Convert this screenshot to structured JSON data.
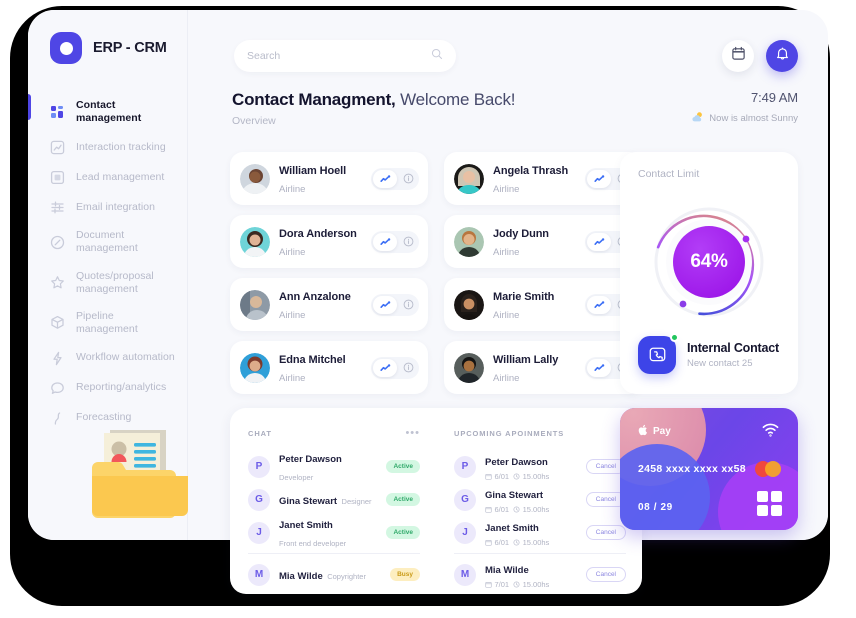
{
  "brand": {
    "name": "ERP - CRM",
    "logo_icon": "circle-logo-icon",
    "accent": "#4f46e5"
  },
  "sidebar": {
    "items": [
      {
        "label": "Contact management",
        "icon": "grid-icon",
        "active": true
      },
      {
        "label": "Interaction tracking",
        "icon": "trend-square-icon",
        "active": false
      },
      {
        "label": "Lead management",
        "icon": "box-icon",
        "active": false
      },
      {
        "label": "Email integration",
        "icon": "sliders-icon",
        "active": false
      },
      {
        "label": "Document management",
        "icon": "compass-icon",
        "active": false
      },
      {
        "label": "Quotes/proposal management",
        "icon": "star-icon",
        "active": false
      },
      {
        "label": "Pipeline management",
        "icon": "package-icon",
        "active": false
      },
      {
        "label": "Workflow automation",
        "icon": "bolt-icon",
        "active": false
      },
      {
        "label": "Reporting/analytics",
        "icon": "chat-bubble-icon",
        "active": false
      },
      {
        "label": "Forecasting",
        "icon": "wave-icon",
        "active": false
      }
    ],
    "illustration": "folder-with-contact-card"
  },
  "header": {
    "search": {
      "placeholder": "Search",
      "value": "",
      "icon": "search-icon"
    },
    "calendar_icon": "calendar-icon",
    "notification_icon": "bell-icon"
  },
  "page": {
    "title_bold": "Contact Managment,",
    "title_rest": " Welcome Back!",
    "subtitle": "Overview",
    "time": "7:49 AM",
    "weather_text": "Now is almost Sunny",
    "weather_icon": "sun-behind-cloud-icon"
  },
  "contacts": [
    {
      "name": "William Hoell",
      "role": "Airline"
    },
    {
      "name": "Angela Thrash",
      "role": "Airline"
    },
    {
      "name": "Dora Anderson",
      "role": "Airline"
    },
    {
      "name": "Jody Dunn",
      "role": "Airline"
    },
    {
      "name": "Ann Anzalone",
      "role": "Airline"
    },
    {
      "name": "Marie Smith",
      "role": "Airline"
    },
    {
      "name": "Edna Mitchel",
      "role": "Airline"
    },
    {
      "name": "William Lally",
      "role": "Airline"
    }
  ],
  "contact_actions": {
    "trend_icon": "trend-up-icon",
    "info_icon": "info-icon"
  },
  "limit_card": {
    "title": "Contact Limit",
    "percent_label": "64%",
    "percent_value": 64,
    "internal_name": "Internal Contact",
    "internal_sub": "New contact 25",
    "internal_icon": "phone-message-icon",
    "status_dot_color": "#22c55e",
    "gauge_colors": {
      "start": "#3b4fd8",
      "mid": "#a855f7",
      "end": "#e8956b"
    },
    "center_fill": "#a21ff0"
  },
  "chat": {
    "title": "CHAT",
    "more_icon": "more-dots-icon",
    "items": [
      {
        "initial": "P",
        "name": "Peter Dawson",
        "role": "Developer",
        "status": "Active",
        "status_type": "active"
      },
      {
        "initial": "G",
        "name": "Gina Stewart",
        "role": "Designer",
        "status": "Active",
        "status_type": "active"
      },
      {
        "initial": "J",
        "name": "Janet Smith",
        "role": "Front end developer",
        "status": "Active",
        "status_type": "active"
      },
      {
        "initial": "M",
        "name": "Mia Wilde",
        "role": "Copyrighter",
        "status": "Busy",
        "status_type": "busy"
      }
    ]
  },
  "appointments": {
    "title": "UPCOMING APOINMENTS",
    "cancel_label": "Cancel",
    "date_icon": "calendar-small-icon",
    "time_icon": "clock-small-icon",
    "items": [
      {
        "initial": "P",
        "name": "Peter Dawson",
        "date": "6/01",
        "time": "15.00hs"
      },
      {
        "initial": "G",
        "name": "Gina Stewart",
        "date": "6/01",
        "time": "15.00hs"
      },
      {
        "initial": "J",
        "name": "Janet Smith",
        "date": "6/01",
        "time": "15.00hs"
      },
      {
        "initial": "M",
        "name": "Mia Wilde",
        "date": "7/01",
        "time": "15.00hs"
      }
    ]
  },
  "payment_card": {
    "wallet_label": "Pay",
    "wallet_icon": "apple-icon",
    "contactless_icon": "wifi-icon",
    "number": "2458 xxxx xxxx xx58",
    "expiry": "08 / 29",
    "network_icon": "mastercard-icon",
    "chip_icon": "chip-icon"
  }
}
